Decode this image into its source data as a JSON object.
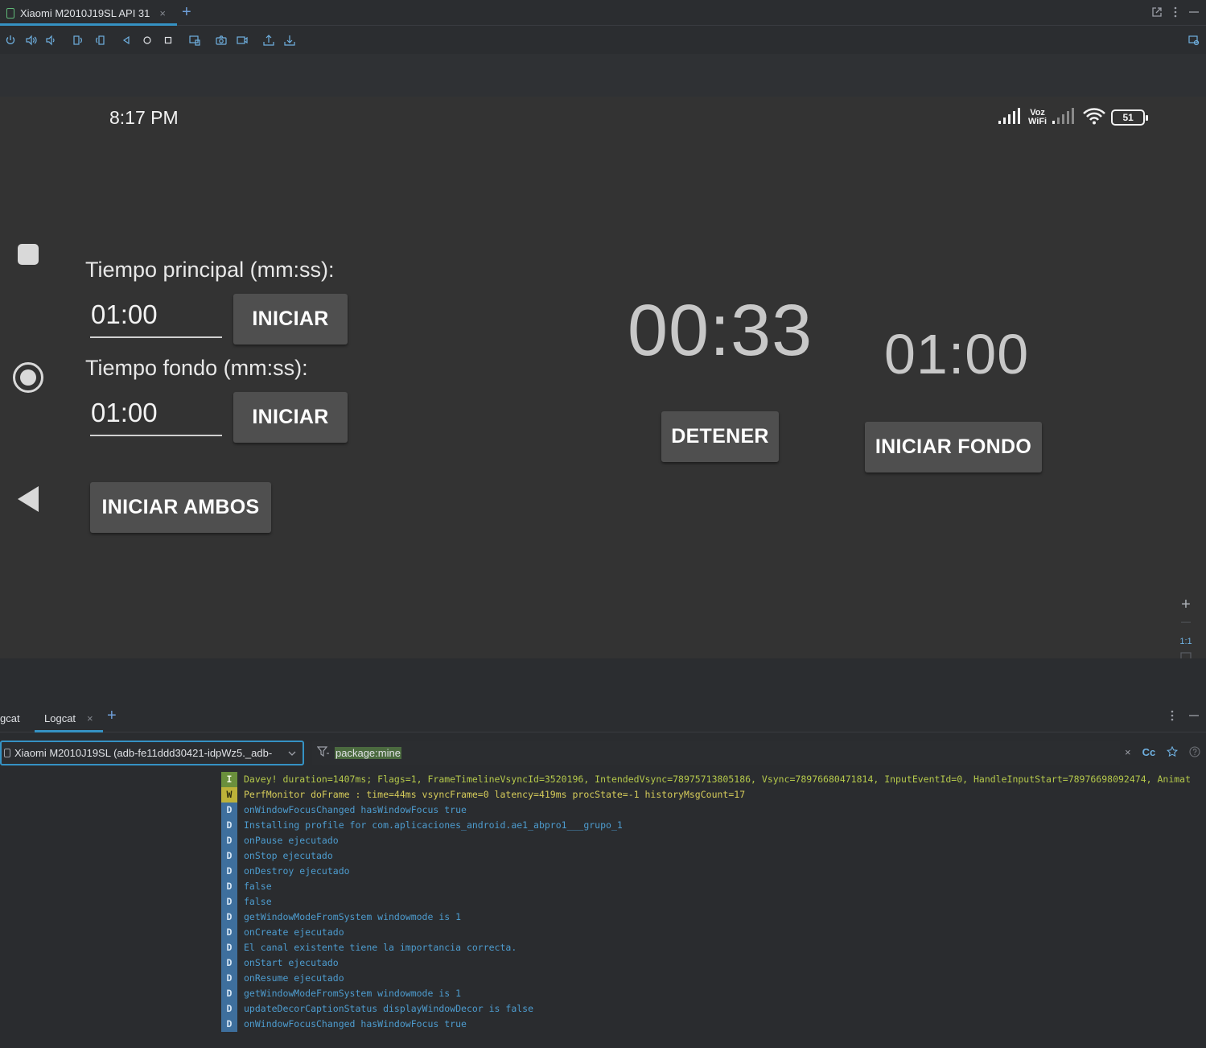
{
  "ide": {
    "device_tab_label": "Xiaomi M2010J19SL API 31",
    "close_glyph": "×",
    "add_glyph": "+",
    "window_icons": [
      "external-link-icon",
      "kebab-menu-icon",
      "minimize-icon"
    ]
  },
  "toolbar": {
    "buttons": [
      "power-icon",
      "volume-up-icon",
      "volume-down-icon",
      "rotate-left-icon",
      "rotate-right-icon",
      "back-icon",
      "home-icon",
      "overview-icon",
      "fold-icon",
      "screenshot-icon",
      "screen-record-icon",
      "export-icon",
      "import-icon"
    ],
    "right_button": "device-frame-icon"
  },
  "device": {
    "status_time": "8:17 PM",
    "voz_wifi_top": "Voz",
    "voz_wifi_bottom": "WiFi",
    "battery_level": "51",
    "labels": {
      "main_time": "Tiempo principal (mm:ss):",
      "bg_time": "Tiempo fondo (mm:ss):"
    },
    "inputs": {
      "main_value": "01:00",
      "bg_value": "01:00"
    },
    "buttons": {
      "start_main": "INICIAR",
      "start_bg": "INICIAR",
      "start_both": "INICIAR AMBOS",
      "stop": "DETENER",
      "start_background": "INICIAR FONDO"
    },
    "main_timer": "00:33",
    "bg_timer": "01:00"
  },
  "zoom": {
    "plus": "+",
    "minus": "—",
    "ratio": "1:1"
  },
  "logcat": {
    "panel_title": "gcat",
    "tab_label": "Logcat",
    "device_select": "Xiaomi M2010J19SL (adb-fe11ddd30421-idpWz5._adb-",
    "filter": "package:mine",
    "filter_actions": [
      "×",
      "Cc"
    ],
    "lines": [
      {
        "level": "I",
        "msg": "Davey! duration=1407ms; Flags=1, FrameTimelineVsyncId=3520196, IntendedVsync=78975713805186, Vsync=78976680471814, InputEventId=0, HandleInputStart=78976698092474, Animat"
      },
      {
        "level": "W",
        "msg": "PerfMonitor doFrame : time=44ms vsyncFrame=0 latency=419ms procState=-1 historyMsgCount=17"
      },
      {
        "level": "D",
        "msg": "onWindowFocusChanged hasWindowFocus true"
      },
      {
        "level": "D",
        "msg": "Installing profile for com.aplicaciones_android.ae1_abpro1___grupo_1"
      },
      {
        "level": "D",
        "msg": "onPause ejecutado"
      },
      {
        "level": "D",
        "msg": "onStop ejecutado"
      },
      {
        "level": "D",
        "msg": "onDestroy ejecutado"
      },
      {
        "level": "D",
        "msg": "false"
      },
      {
        "level": "D",
        "msg": "false"
      },
      {
        "level": "D",
        "msg": "getWindowModeFromSystem  windowmode is 1"
      },
      {
        "level": "D",
        "msg": "onCreate ejecutado"
      },
      {
        "level": "D",
        "msg": "El canal existente tiene la importancia correcta."
      },
      {
        "level": "D",
        "msg": "onStart ejecutado"
      },
      {
        "level": "D",
        "msg": "onResume ejecutado"
      },
      {
        "level": "D",
        "msg": "getWindowModeFromSystem  windowmode is 1"
      },
      {
        "level": "D",
        "msg": "updateDecorCaptionStatus displayWindowDecor is false"
      },
      {
        "level": "D",
        "msg": "onWindowFocusChanged hasWindowFocus true"
      }
    ]
  }
}
